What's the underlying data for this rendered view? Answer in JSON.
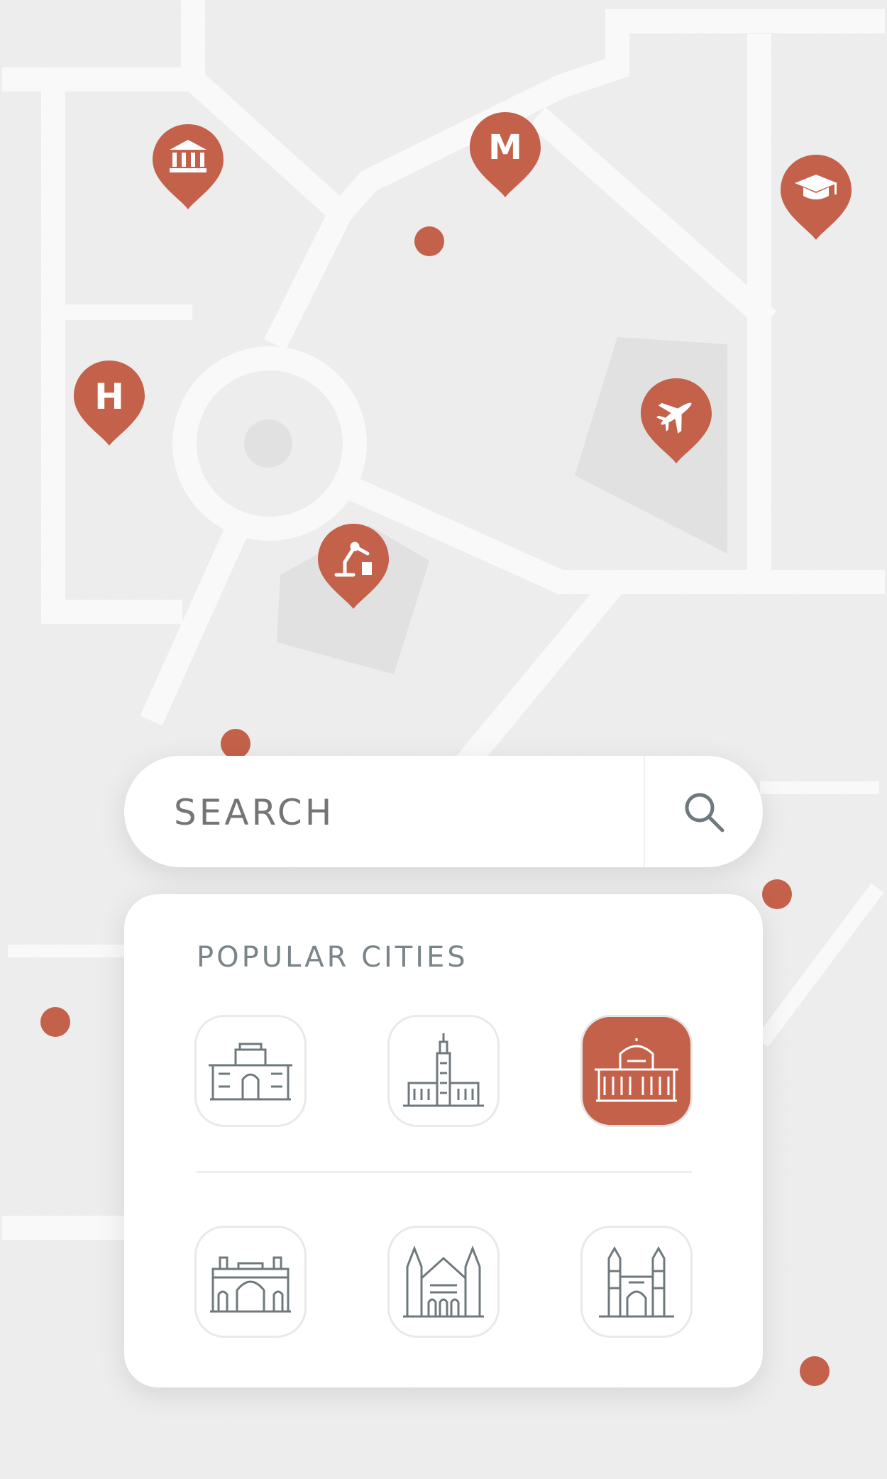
{
  "colors": {
    "accent": "#c4614a",
    "text_muted": "#7a8589",
    "icon_stroke": "#6f797d",
    "background": "#eeeeee",
    "road": "#fafafa",
    "block": "#e2e2e2"
  },
  "map": {
    "pins": [
      {
        "icon": "bank-icon",
        "name": "map-pin-bank"
      },
      {
        "icon": "letter-m-icon",
        "label": "M",
        "name": "map-pin-metro"
      },
      {
        "icon": "graduation-cap-icon",
        "name": "map-pin-university"
      },
      {
        "icon": "letter-h-icon",
        "label": "H",
        "name": "map-pin-hospital"
      },
      {
        "icon": "airplane-icon",
        "name": "map-pin-airport"
      },
      {
        "icon": "robot-arm-icon",
        "name": "map-pin-industry"
      }
    ]
  },
  "search": {
    "placeholder": "SEARCH",
    "button_icon": "search-icon"
  },
  "popular": {
    "title": "POPULAR CITIES",
    "cities": [
      {
        "icon": "city-landmark-palace-icon",
        "selected": false
      },
      {
        "icon": "city-landmark-tower-icon",
        "selected": false
      },
      {
        "icon": "city-landmark-domed-hall-icon",
        "selected": true
      },
      {
        "icon": "city-landmark-gateway-arch-icon",
        "selected": false
      },
      {
        "icon": "city-landmark-cathedral-icon",
        "selected": false
      },
      {
        "icon": "city-landmark-twin-minaret-icon",
        "selected": false
      }
    ]
  }
}
